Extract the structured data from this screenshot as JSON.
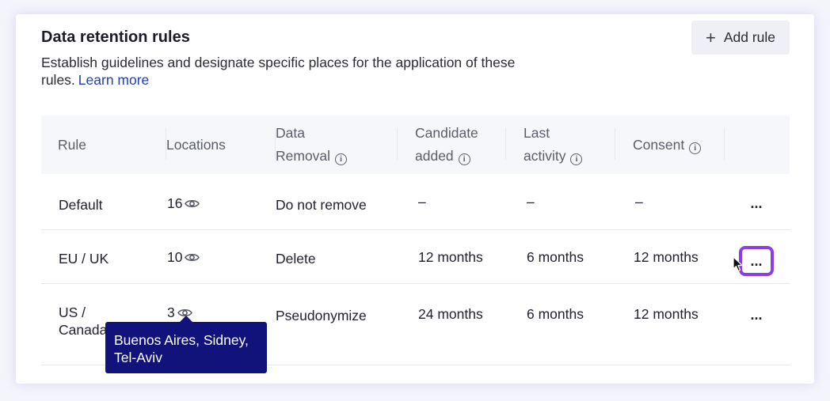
{
  "header": {
    "title": "Data retention rules",
    "description": "Establish guidelines and designate specific places for the application of these rules.",
    "learn_more": "Learn more",
    "add_rule_label": "Add rule"
  },
  "table": {
    "columns": [
      {
        "line1": "Rule",
        "line2": ""
      },
      {
        "line1": "Locations",
        "line2": ""
      },
      {
        "line1": "Data",
        "line2": "Removal"
      },
      {
        "line1": "Candidate",
        "line2": "added"
      },
      {
        "line1": "Last",
        "line2": "activity"
      },
      {
        "line1": "Consent",
        "line2": ""
      }
    ],
    "rows": [
      {
        "rule": "Default",
        "locations": "16",
        "removal": "Do not remove",
        "candidate_added": "–",
        "last_activity": "–",
        "consent": "–"
      },
      {
        "rule": "EU / UK",
        "locations": "10",
        "removal": "Delete",
        "candidate_added": "12 months",
        "last_activity": "6 months",
        "consent": "12 months"
      },
      {
        "rule": "US / Canada",
        "locations": "3",
        "removal": "Pseudonymize",
        "candidate_added": "24 months",
        "last_activity": "6 months",
        "consent": "12 months"
      }
    ],
    "more_label": "..."
  },
  "tooltip": {
    "text": "Buenos Aires, Sidney, Tel-Aviv"
  },
  "icons": {
    "add": "plus-icon",
    "view": "eye-icon",
    "info": "info-icon",
    "more": "more-icon"
  },
  "colors": {
    "accent_focus": "#8b3de8",
    "tooltip_bg": "#12137a",
    "link": "#1f3fae"
  }
}
